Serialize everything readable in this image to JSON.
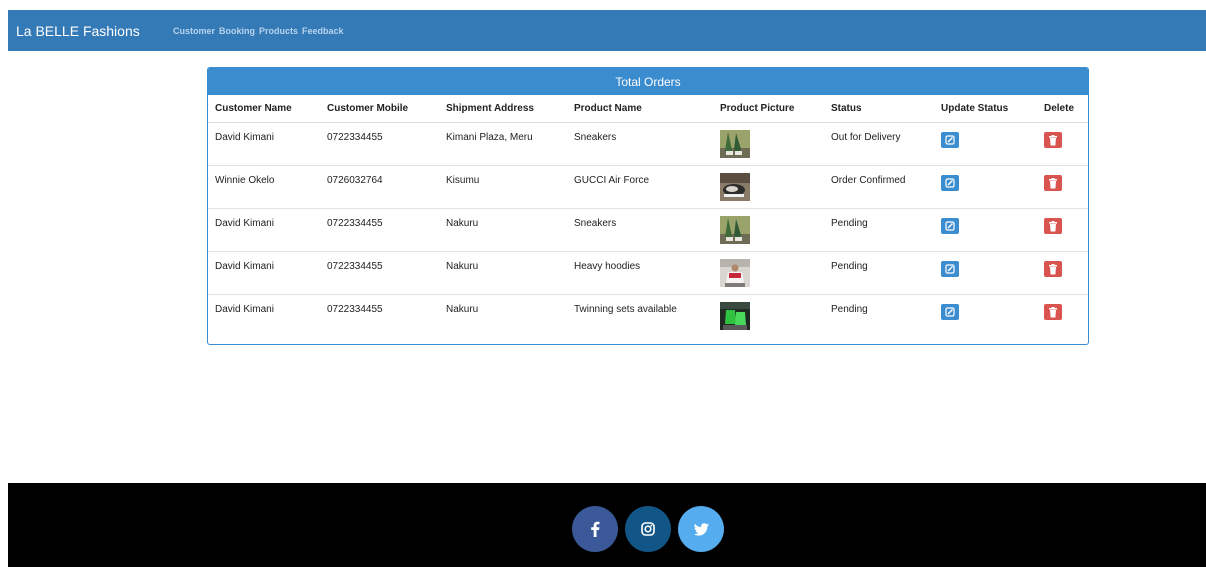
{
  "navbar": {
    "brand": "La BELLE Fashions",
    "links": [
      "Customer",
      "Booking",
      "Products",
      "Feedback"
    ]
  },
  "panel": {
    "title": "Total Orders"
  },
  "table": {
    "headers": [
      "Customer Name",
      "Customer Mobile",
      "Shipment Address",
      "Product Name",
      "Product Picture",
      "Status",
      "Update Status",
      "Delete"
    ],
    "rows": [
      {
        "name": "David Kimani",
        "mobile": "0722334455",
        "address": "Kimani Plaza, Meru",
        "product": "Sneakers",
        "picture": "sneakers-photo",
        "status": "Out for Delivery"
      },
      {
        "name": "Winnie Okelo",
        "mobile": "0726032764",
        "address": "Kisumu",
        "product": "GUCCI Air Force",
        "picture": "gucci-shoes-photo",
        "status": "Order Confirmed"
      },
      {
        "name": "David Kimani",
        "mobile": "0722334455",
        "address": "Nakuru",
        "product": "Sneakers",
        "picture": "sneakers-photo",
        "status": "Pending"
      },
      {
        "name": "David Kimani",
        "mobile": "0722334455",
        "address": "Nakuru",
        "product": "Heavy hoodies",
        "picture": "hoodie-photo",
        "status": "Pending"
      },
      {
        "name": "David Kimani",
        "mobile": "0722334455",
        "address": "Nakuru",
        "product": "Twinning sets available",
        "picture": "twinning-set-photo",
        "status": "Pending"
      }
    ]
  },
  "icons": {
    "update": "edit-icon",
    "delete": "trash-icon",
    "social": [
      "facebook-icon",
      "instagram-icon",
      "twitter-icon"
    ]
  },
  "colors": {
    "navbar": "#337ab7",
    "panel_heading": "#3a8ccf",
    "edit_button": "#3c8dd0",
    "delete_button": "#d9534f",
    "facebook": "#3b5998",
    "instagram": "#125688",
    "twitter": "#55acee",
    "footer": "#000000"
  }
}
